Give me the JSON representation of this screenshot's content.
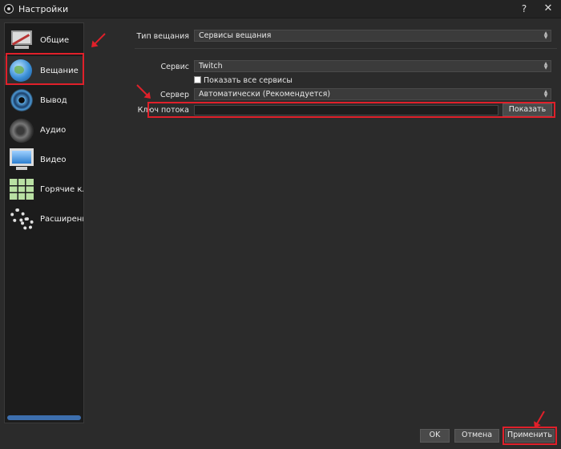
{
  "window": {
    "title": "Настройки",
    "help": "?",
    "close": "✕"
  },
  "sidebar": {
    "items": [
      {
        "label": "Общие",
        "icon": "general-icon"
      },
      {
        "label": "Вещание",
        "icon": "stream-icon"
      },
      {
        "label": "Вывод",
        "icon": "output-icon"
      },
      {
        "label": "Аудио",
        "icon": "audio-icon"
      },
      {
        "label": "Видео",
        "icon": "video-icon"
      },
      {
        "label": "Горячие клави",
        "icon": "hotkeys-icon"
      },
      {
        "label": "Расширенные",
        "icon": "advanced-icon"
      }
    ],
    "active": "Вещание"
  },
  "stream": {
    "type_label": "Тип вещания",
    "type_value": "Сервисы вещания",
    "service_label": "Сервис",
    "service_value": "Twitch",
    "show_all_label": "Показать все сервисы",
    "show_all_checked": false,
    "server_label": "Сервер",
    "server_value": "Автоматически (Рекомендуется)",
    "key_label": "Ключ потока",
    "key_value": "",
    "show_button": "Показать"
  },
  "footer": {
    "ok": "OK",
    "cancel": "Отмена",
    "apply": "Применить"
  },
  "colors": {
    "highlight": "#e0202a",
    "background": "#2b2b2b",
    "sidebar_bg": "#1c1c1c"
  }
}
